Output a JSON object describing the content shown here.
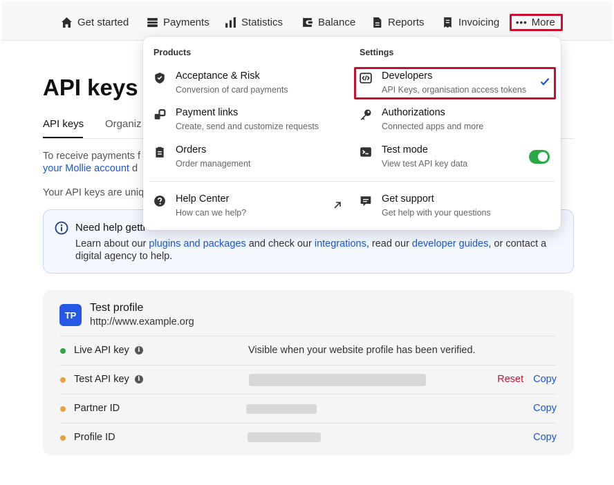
{
  "nav": {
    "items": [
      {
        "label": "Get started",
        "icon": "home-icon"
      },
      {
        "label": "Payments",
        "icon": "payments-icon"
      },
      {
        "label": "Statistics",
        "icon": "bar-chart-icon"
      },
      {
        "label": "Balance",
        "icon": "wallet-icon"
      },
      {
        "label": "Reports",
        "icon": "document-icon"
      },
      {
        "label": "Invoicing",
        "icon": "receipt-icon"
      }
    ],
    "more": {
      "dots": "•••",
      "label": "More"
    }
  },
  "page": {
    "title": "API keys",
    "tabs": [
      "API keys",
      "Organiz"
    ],
    "intro1_start": "To receive payments f",
    "intro1_link": "your Mollie account",
    "intro1_end": " d",
    "intro2": "Your API keys are uniq"
  },
  "help": {
    "title": "Need help getti",
    "text_1": "Learn about our ",
    "link_1": "plugins and packages",
    "text_2": " and check our ",
    "link_2": "integrations",
    "text_3": ", read our ",
    "link_3": "developer guides",
    "text_4": ", or contact a digital agency to help."
  },
  "profile": {
    "initials": "TP",
    "name": "Test profile",
    "url": "http://www.example.org",
    "rows": [
      {
        "label": "Live API key",
        "has_info": true,
        "status": "green",
        "value": "Visible when your website profile has been verified."
      },
      {
        "label": "Test API key",
        "has_info": true,
        "status": "orange",
        "reset": "Reset",
        "copy": "Copy"
      },
      {
        "label": "Partner ID",
        "status": "orange",
        "copy": "Copy"
      },
      {
        "label": "Profile ID",
        "status": "orange",
        "copy": "Copy"
      }
    ]
  },
  "dropdown": {
    "products_heading": "Products",
    "settings_heading": "Settings",
    "products": [
      {
        "title": "Acceptance & Risk",
        "subtitle": "Conversion of card payments",
        "icon": "shield-check-icon"
      },
      {
        "title": "Payment links",
        "subtitle": "Create, send and customize requests",
        "icon": "links-icon"
      },
      {
        "title": "Orders",
        "subtitle": "Order management",
        "icon": "clipboard-icon"
      },
      {
        "title": "Help Center",
        "subtitle": "How can we help?",
        "icon": "question-circle-icon"
      }
    ],
    "settings": [
      {
        "title": "Developers",
        "subtitle": "API Keys, organisation access tokens",
        "icon": "code-icon",
        "selected": true
      },
      {
        "title": "Authorizations",
        "subtitle": "Connected apps and more",
        "icon": "key-icon"
      },
      {
        "title": "Test mode",
        "subtitle": "View test API key data",
        "icon": "terminal-icon",
        "toggle_on": true
      },
      {
        "title": "Get support",
        "subtitle": "Get help with your questions",
        "icon": "chat-icon"
      }
    ]
  },
  "colors": {
    "accent": "#1a56db",
    "highlight_border": "#c8102e",
    "status_green": "#2aa845",
    "status_orange": "#e8a23a",
    "avatar_bg": "#2757e6"
  }
}
